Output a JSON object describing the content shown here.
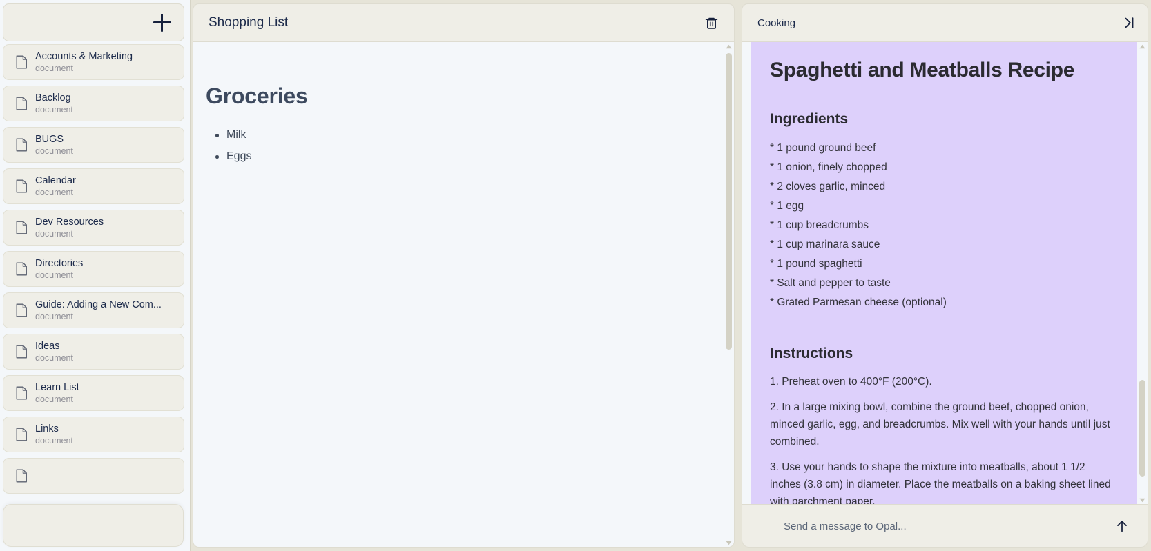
{
  "sidebar": {
    "add_button_label": "+",
    "items": [
      {
        "title": "Accounts & Marketing",
        "subtitle": "document",
        "icon": "document-icon"
      },
      {
        "title": "Backlog",
        "subtitle": "document",
        "icon": "document-icon"
      },
      {
        "title": "BUGS",
        "subtitle": "document",
        "icon": "document-icon"
      },
      {
        "title": "Calendar",
        "subtitle": "document",
        "icon": "document-icon"
      },
      {
        "title": "Dev Resources",
        "subtitle": "document",
        "icon": "document-icon"
      },
      {
        "title": "Directories",
        "subtitle": "document",
        "icon": "document-icon"
      },
      {
        "title": "Guide: Adding a New Com...",
        "subtitle": "document",
        "icon": "document-icon"
      },
      {
        "title": "Ideas",
        "subtitle": "document",
        "icon": "document-icon"
      },
      {
        "title": "Learn List",
        "subtitle": "document",
        "icon": "document-icon"
      },
      {
        "title": "Links",
        "subtitle": "document",
        "icon": "document-icon"
      },
      {
        "title": "",
        "subtitle": "",
        "icon": "document-icon"
      }
    ]
  },
  "center": {
    "title": "Shopping List",
    "delete_icon": "trash-icon",
    "document": {
      "heading": "Groceries",
      "bullets": [
        "Milk",
        "Eggs"
      ]
    }
  },
  "chat": {
    "title": "Cooking",
    "collapse_icon": "collapse-panel-right-icon",
    "message": {
      "heading": "Spaghetti and Meatballs Recipe",
      "ingredients_heading": "Ingredients",
      "ingredients": [
        "* 1 pound ground beef",
        "* 1 onion, finely chopped",
        "* 2 cloves garlic, minced",
        "* 1 egg",
        "* 1 cup breadcrumbs",
        "* 1 cup marinara sauce",
        "* 1 pound spaghetti",
        "* Salt and pepper to taste",
        "* Grated Parmesan cheese (optional)"
      ],
      "instructions_heading": "Instructions",
      "instructions": [
        "1. Preheat oven to 400°F (200°C).",
        "2. In a large mixing bowl, combine the ground beef, chopped onion, minced garlic, egg, and breadcrumbs. Mix well with your hands until just combined.",
        "3. Use your hands to shape the mixture into meatballs, about 1 1/2 inches (3.8 cm) in diameter. Place the meatballs on a baking sheet lined with parchment paper."
      ]
    },
    "input": {
      "value": "",
      "placeholder": "Send a message to Opal..."
    },
    "send_icon": "arrow-up-icon"
  },
  "colors": {
    "panel_chrome": "#efeee7",
    "document_bg": "#f4f7fa",
    "message_bubble": "#ddd0fb",
    "text_primary": "#1d2b4b",
    "text_muted": "#8e8e96",
    "app_bg": "#e6e4d8"
  }
}
